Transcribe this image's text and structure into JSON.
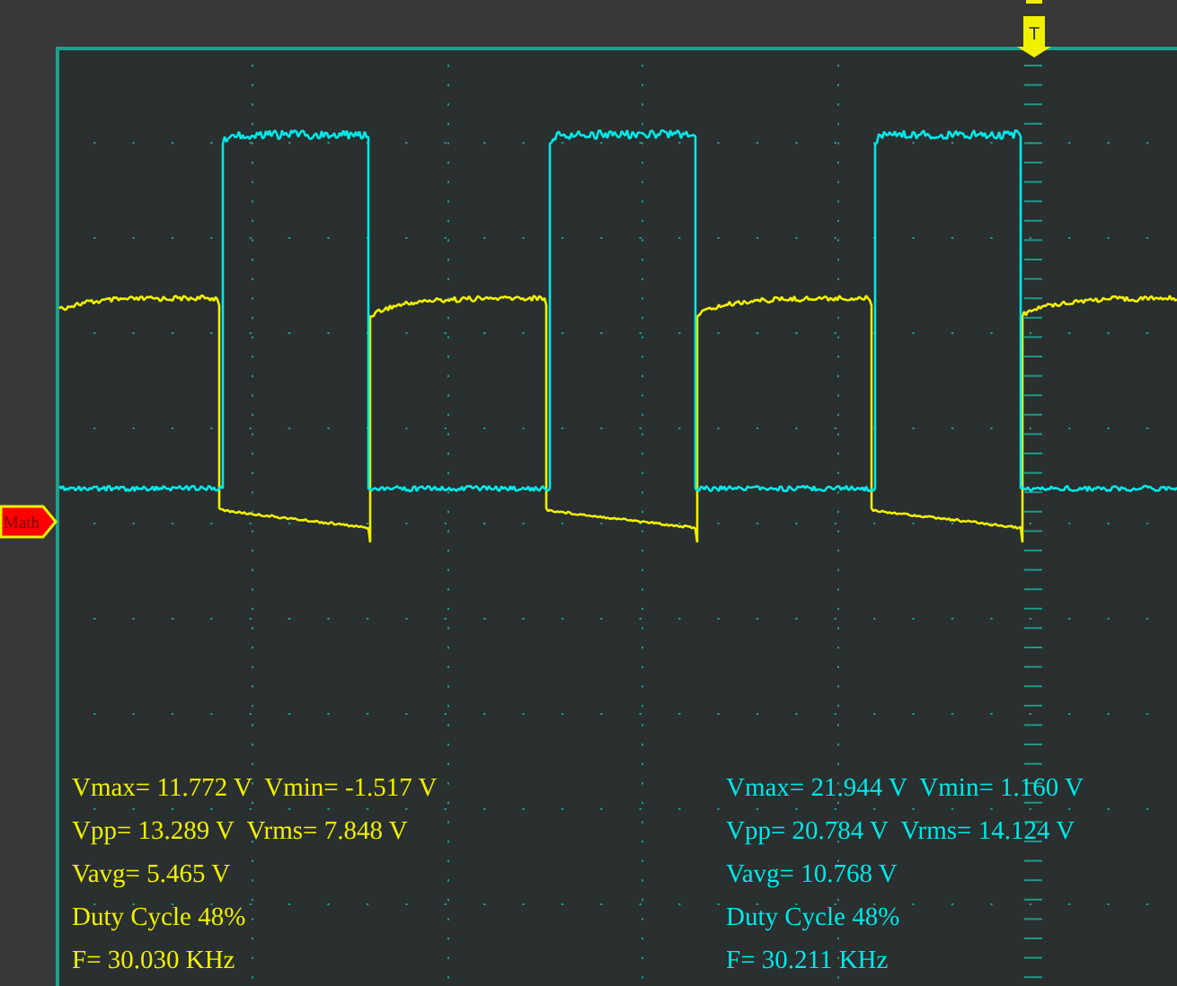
{
  "markers": [
    {
      "kind": "math",
      "label": "Math"
    },
    {
      "kind": "trigger",
      "label": "T"
    }
  ],
  "channels": [
    {
      "color": "#f0f000",
      "measurements": [
        "Vmax= 11.772 V  Vmin= -1.517 V",
        "Vpp= 13.289 V  Vrms= 7.848 V",
        "Vavg= 5.465 V",
        "Duty Cycle 48%",
        "F= 30.030 KHz"
      ]
    },
    {
      "color": "#00e8e8",
      "measurements": [
        "Vmax= 21.944 V  Vmin= 1.160 V",
        "Vpp= 20.784 V  Vrms= 14.124 V",
        "Vavg= 10.768 V",
        "Duty Cycle 48%",
        "F= 30.211 KHz"
      ]
    }
  ]
}
